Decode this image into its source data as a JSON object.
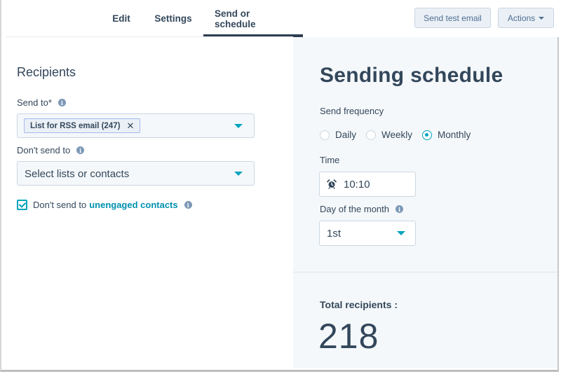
{
  "nav": {
    "tabs": [
      {
        "label": "Edit",
        "active": false
      },
      {
        "label": "Settings",
        "active": false
      },
      {
        "label": "Send or schedule",
        "active": true
      }
    ],
    "send_test_label": "Send test email",
    "actions_label": "Actions"
  },
  "recipients": {
    "title": "Recipients",
    "send_to_label": "Send to*",
    "send_to_chip": "List for RSS email (247)",
    "chip_remove_glyph": "✕",
    "dont_send_label": "Don't send to",
    "dont_send_placeholder": "Select lists or contacts",
    "unengaged_prefix": "Don't send to",
    "unengaged_link": "unengaged contacts",
    "unengaged_checked": true,
    "info_glyph": "i"
  },
  "schedule": {
    "title": "Sending schedule",
    "frequency_label": "Send frequency",
    "frequency_options": [
      "Daily",
      "Weekly",
      "Monthly"
    ],
    "frequency_selected": "Monthly",
    "time_label": "Time",
    "time_value": "10:10",
    "day_label": "Day of the month",
    "day_value": "1st",
    "total_label": "Total recipients :",
    "total_value": "218"
  },
  "colors": {
    "accent": "#00a4bd",
    "link": "#0091ae",
    "text": "#33475b",
    "panel_bg": "#f5f8fa",
    "chip_border": "#a7b8f0"
  }
}
